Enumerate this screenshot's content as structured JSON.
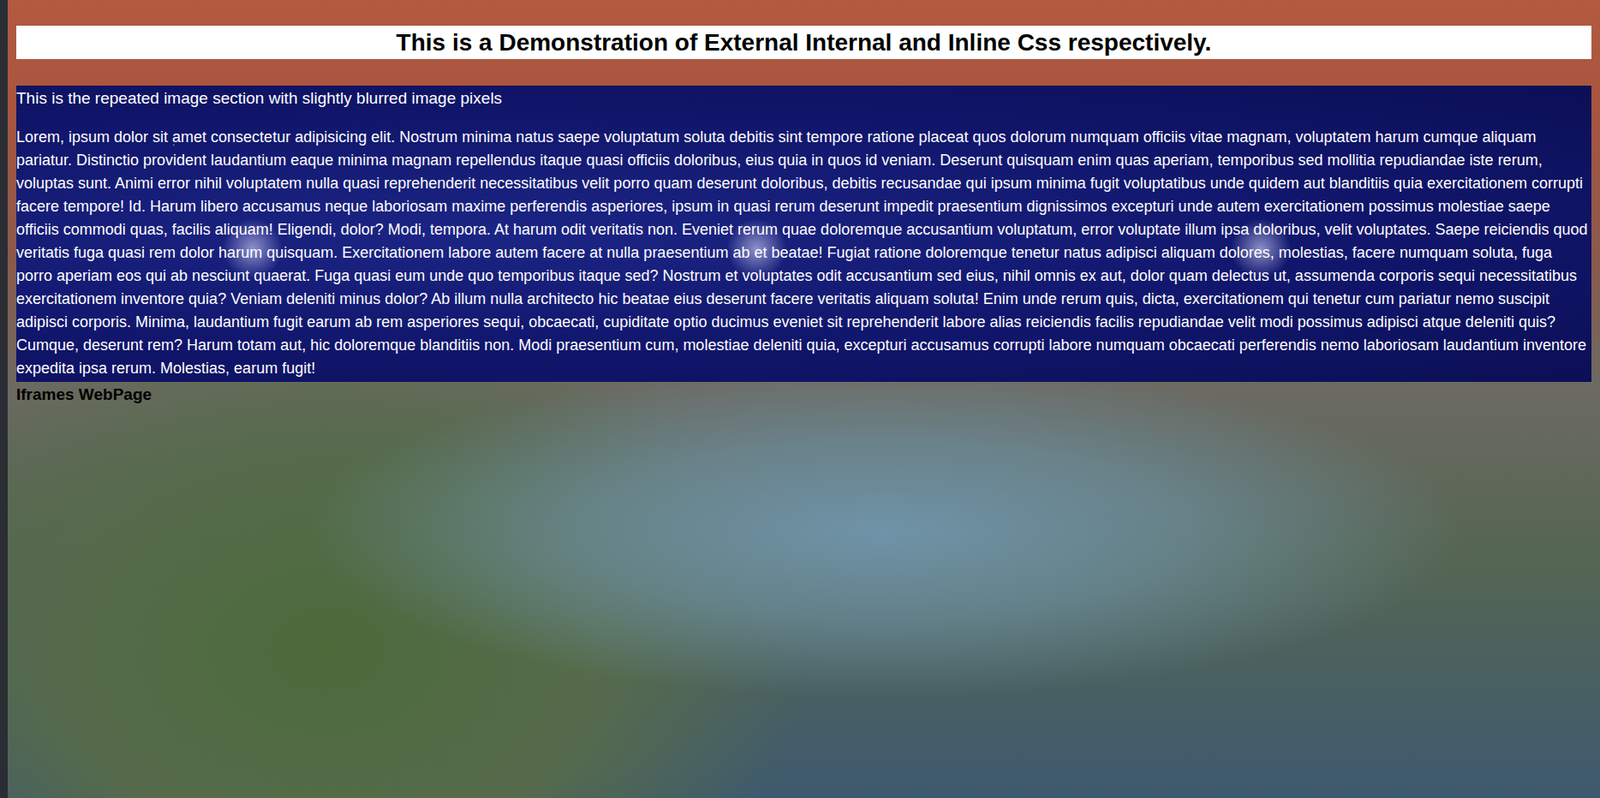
{
  "page": {
    "heading": "This is a Demonstration of External Internal and Inline Css respectively."
  },
  "section": {
    "caption": "This is the repeated image section with slightly blurred image pixels",
    "paragraph": "Lorem, ipsum dolor sit amet consectetur adipisicing elit. Nostrum minima natus saepe voluptatum soluta debitis sint tempore ratione placeat quos dolorum numquam officiis vitae magnam, voluptatem harum cumque aliquam pariatur. Distinctio provident laudantium eaque minima magnam repellendus itaque quasi officiis doloribus, eius quia in quos id veniam. Deserunt quisquam enim quas aperiam, temporibus sed mollitia repudiandae iste rerum, voluptas sunt. Animi error nihil voluptatem nulla quasi reprehenderit necessitatibus velit porro quam deserunt doloribus, debitis recusandae qui ipsum minima fugit voluptatibus unde quidem aut blanditiis quia exercitationem corrupti facere tempore! Id. Harum libero accusamus neque laboriosam maxime perferendis asperiores, ipsum in quasi rerum deserunt impedit praesentium dignissimos excepturi unde autem exercitationem possimus molestiae saepe officiis commodi quas, facilis aliquam! Eligendi, dolor? Modi, tempora. At harum odit veritatis non. Eveniet rerum quae doloremque accusantium voluptatum, error voluptate illum ipsa doloribus, velit voluptates. Saepe reiciendis quod veritatis fuga quasi rem dolor harum quisquam. Exercitationem labore autem facere at nulla praesentium ab et beatae! Fugiat ratione doloremque tenetur natus adipisci aliquam dolores, molestias, facere numquam soluta, fuga porro aperiam eos qui ab nesciunt quaerat. Fuga quasi eum unde quo temporibus itaque sed? Nostrum et voluptates odit accusantium sed eius, nihil omnis ex aut, dolor quam delectus ut, assumenda corporis sequi necessitatibus exercitationem inventore quia? Veniam deleniti minus dolor? Ab illum nulla architecto hic beatae eius deserunt facere veritatis aliquam soluta! Enim unde rerum quis, dicta, exercitationem qui tenetur cum pariatur nemo suscipit adipisci corporis. Minima, laudantium fugit earum ab rem asperiores sequi, obcaecati, cupiditate optio ducimus eveniet sit reprehenderit labore alias reiciendis facilis repudiandae velit modi possimus adipisci atque deleniti quis? Cumque, deserunt rem? Harum totam aut, hic doloremque blanditiis non. Modi praesentium cum, molestiae deleniti quia, excepturi accusamus corrupti labore numquam obcaecati perferendis nemo laboriosam laudantium inventore expedita ipsa rerum. Molestias, earum fugit!"
  },
  "iframes": {
    "heading": "Iframes WebPage"
  }
}
